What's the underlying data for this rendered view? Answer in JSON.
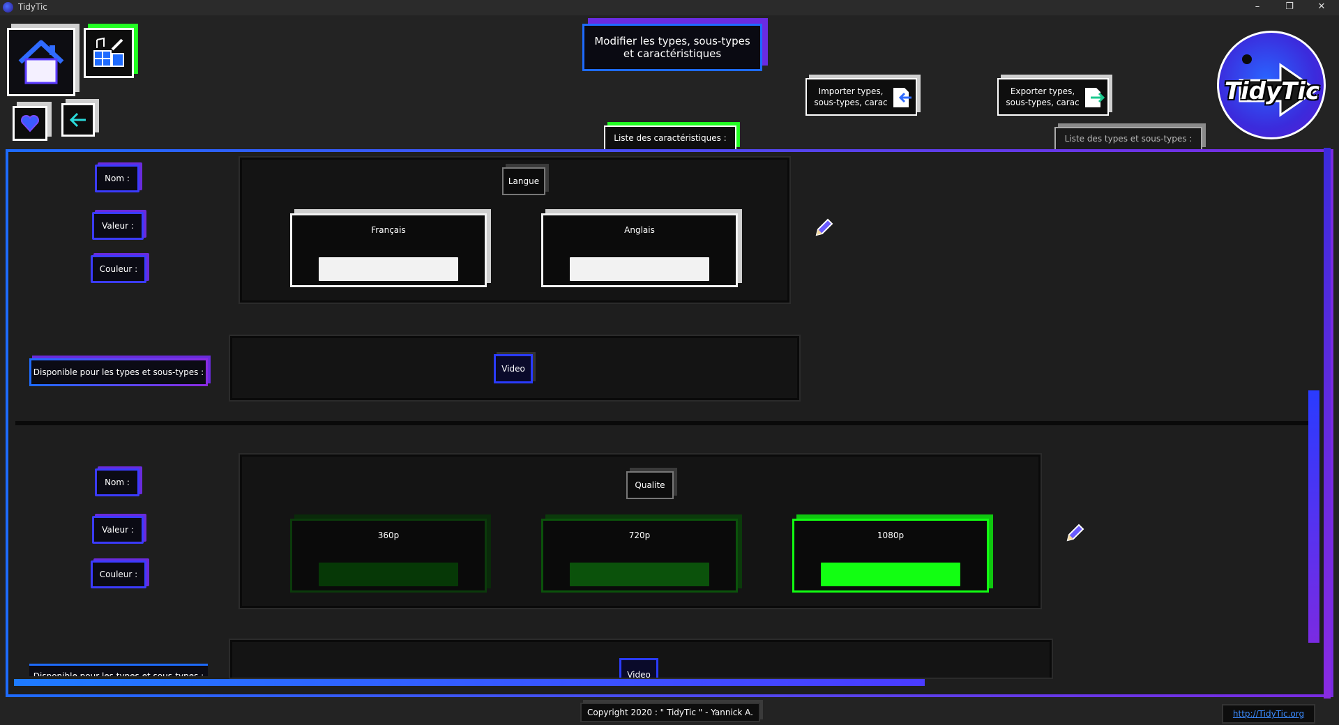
{
  "window": {
    "title": "TidyTic",
    "minimize": "–",
    "maximize": "❐",
    "close": "✕"
  },
  "header": {
    "main_title_line1": "Modifier les types, sous-types",
    "main_title_line2": "et caractéristiques",
    "import_line1": "Importer types,",
    "import_line2": "sous-types, carac",
    "export_line1": "Exporter types,",
    "export_line2": "sous-types, carac",
    "tab_characteristics": "Liste des caractéristiques :",
    "tab_types": "Liste des types et sous-types :",
    "logo_text": "TidyTic"
  },
  "labels": {
    "name": "Nom :",
    "value": "Valeur :",
    "color": "Couleur :",
    "available": "Disponible pour les types et sous-types :"
  },
  "characteristics": [
    {
      "name": "Langue",
      "values": [
        {
          "label": "Français",
          "color": "#f2f2f2"
        },
        {
          "label": "Anglais",
          "color": "#f2f2f2"
        }
      ],
      "types": [
        "Video"
      ]
    },
    {
      "name": "Qualite",
      "values": [
        {
          "label": "360p",
          "color": "#063806"
        },
        {
          "label": "720p",
          "color": "#0b520b"
        },
        {
          "label": "1080p",
          "color": "#12ff12"
        }
      ],
      "types": [
        "Video"
      ]
    }
  ],
  "footer": {
    "copyright": "Copyright 2020 : \" TidyTic \" - Yannick A.",
    "link": "http://TidyTic.org"
  },
  "colors": {
    "accent_blue": "#1e6bff",
    "accent_purple": "#8a2be2",
    "accent_green": "#22ff22"
  }
}
